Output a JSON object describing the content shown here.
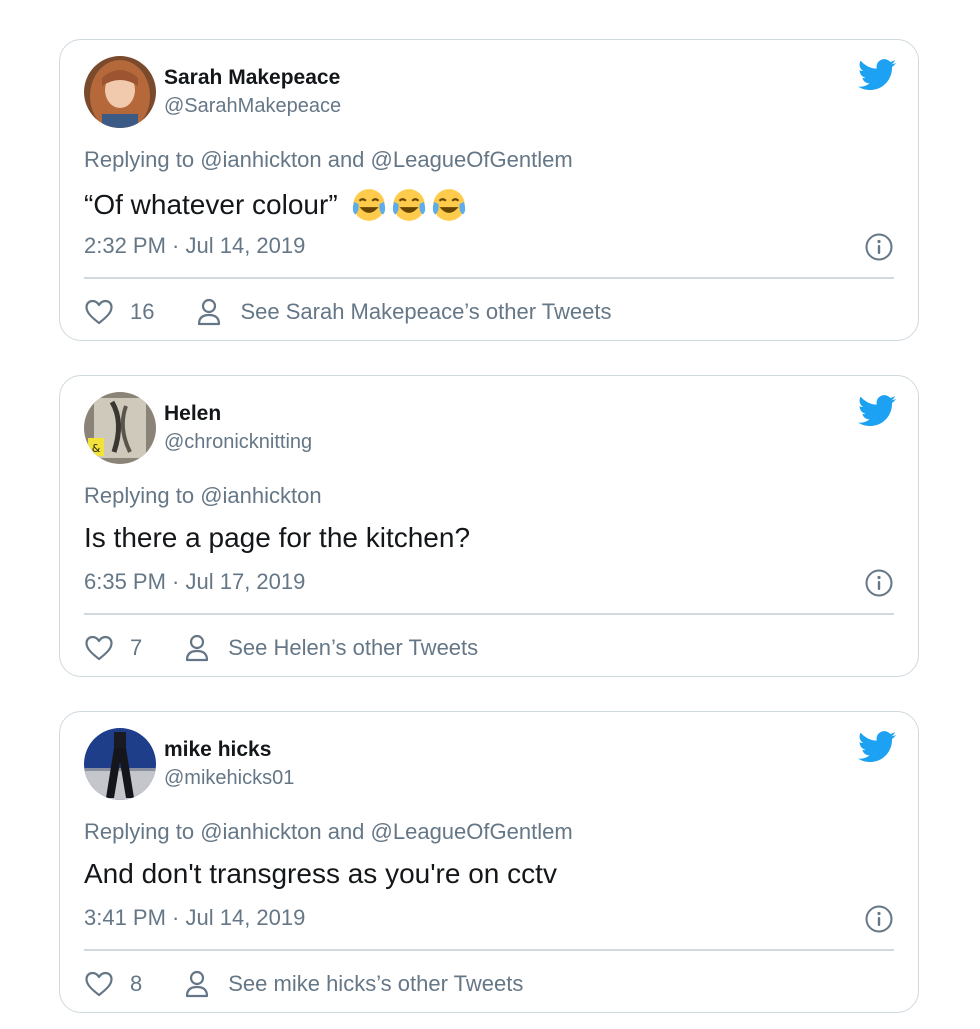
{
  "tweets": [
    {
      "name": "Sarah Makepeace",
      "handle": "@SarahMakepeace",
      "reply_prefix": "Replying to ",
      "reply_users": [
        "@ianhickton",
        "@LeagueOfGentlem"
      ],
      "reply_joiner": " and ",
      "text": "“Of whatever colour”",
      "emojis": [
        "face-with-tears-of-joy",
        "face-with-tears-of-joy",
        "face-with-tears-of-joy"
      ],
      "timestamp": "2:32 PM · Jul 14, 2019",
      "likes": "16",
      "other_tweets": "See Sarah Makepeace’s other Tweets"
    },
    {
      "name": "Helen",
      "handle": "@chronicknitting",
      "reply_prefix": "Replying to ",
      "reply_users": [
        "@ianhickton"
      ],
      "reply_joiner": "",
      "text": "Is there a page for the kitchen?",
      "emojis": [],
      "timestamp": "6:35 PM · Jul 17, 2019",
      "likes": "7",
      "other_tweets": "See Helen’s other Tweets"
    },
    {
      "name": "mike hicks",
      "handle": "@mikehicks01",
      "reply_prefix": "Replying to ",
      "reply_users": [
        "@ianhickton",
        "@LeagueOfGentlem"
      ],
      "reply_joiner": " and ",
      "text": "And don't transgress as you're on cctv",
      "emojis": [],
      "timestamp": "3:41 PM · Jul 14, 2019",
      "likes": "8",
      "other_tweets": "See mike hicks’s other Tweets"
    }
  ],
  "icons": {
    "brand": "twitter-bird-icon",
    "like": "heart-icon",
    "profile": "person-icon",
    "info": "info-icon"
  },
  "colors": {
    "brand_blue": "#1da1f2",
    "muted_text": "#657786",
    "border": "#cfd9de",
    "text": "#14171a"
  }
}
